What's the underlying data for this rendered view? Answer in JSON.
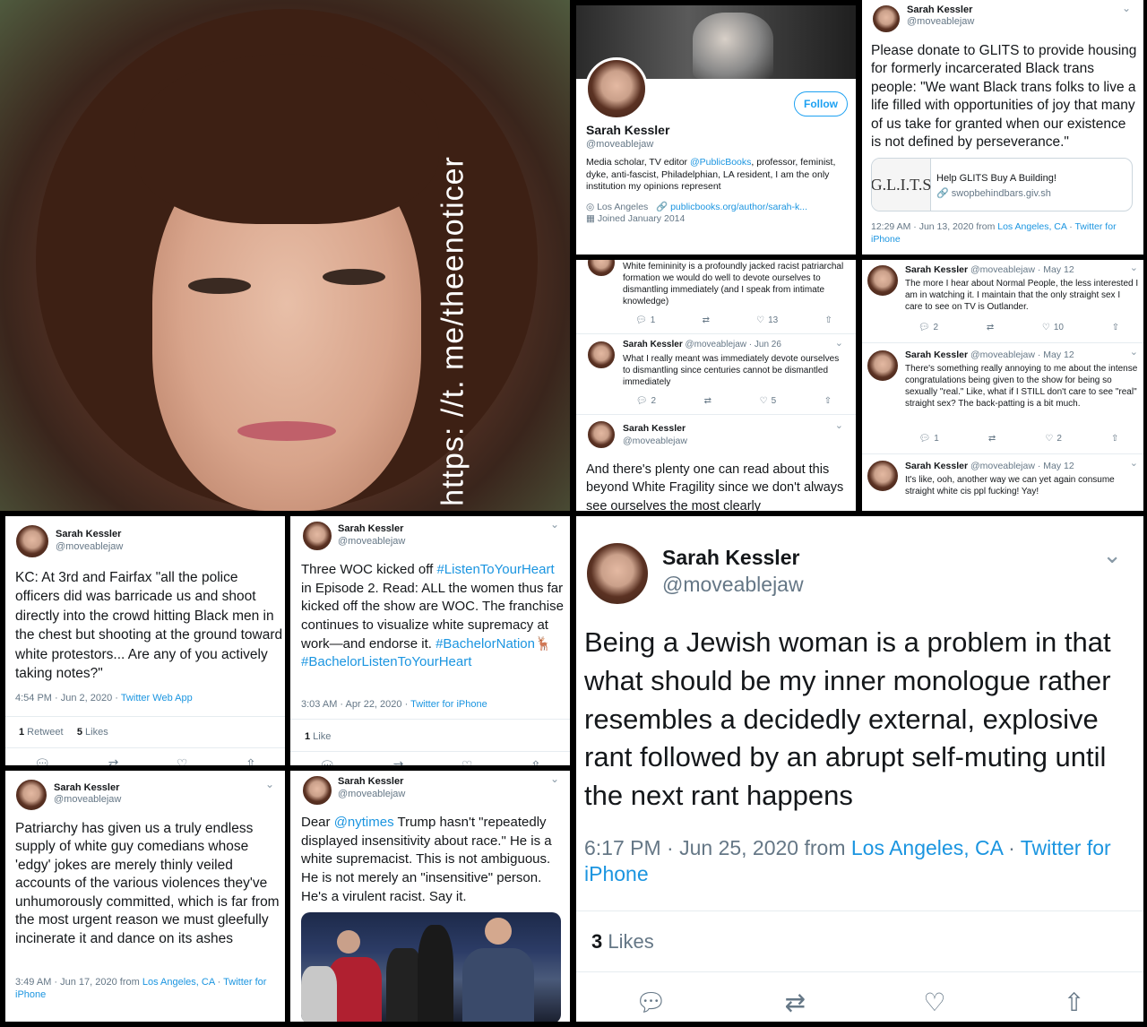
{
  "watermark": "https: //t. me/theenoticer",
  "profile": {
    "name": "Sarah Kessler",
    "handle": "@moveablejaw",
    "follow_label": "Follow",
    "bio_prefix": "Media scholar, TV editor ",
    "bio_link": "@PublicBooks",
    "bio_suffix": ", professor, feminist, dyke, anti-fascist, Philadelphian, LA resident, I am the only institution my opinions represent",
    "location": "Los Angeles",
    "website": "publicbooks.org/author/sarah-k...",
    "joined": "Joined January 2014"
  },
  "glits": {
    "name": "Sarah Kessler",
    "handle": "@moveablejaw",
    "text": "Please donate to GLITS to provide housing for formerly incarcerated Black trans people: \"We want Black trans folks to live a life filled with opportunities of joy that many of us take for granted when our existence is not defined by perseverance.\"",
    "card_thumb": "G.L.I.T.S",
    "card_title": "Help GLITS Buy A Building!",
    "card_url": "swopbehindbars.giv.sh",
    "time": "12:29 AM · Jun 13, 2020 from ",
    "place": "Los Angeles, CA",
    "sep": " · ",
    "source": "Twitter for iPhone"
  },
  "thread": {
    "t1_text": "White femininity is a profoundly jacked racist patriarchal formation we would do well to devote ourselves to dismantling immediately (and I speak from intimate knowledge)",
    "t1_reply": "1",
    "t1_like": "13",
    "t2_name": "Sarah Kessler",
    "t2_handle": "@moveablejaw · Jun 26",
    "t2_text": "What I really meant was immediately devote ourselves to dismantling since centuries cannot be dismantled immediately",
    "t2_reply": "2",
    "t2_like": "5",
    "t3_name": "Sarah Kessler",
    "t3_handle": "@moveablejaw",
    "t3_text": "And there's plenty one can read about this beyond White Fragility since we don't always see ourselves the most clearly"
  },
  "normal_people": {
    "t1_name": "Sarah Kessler",
    "t1_handle": "@moveablejaw · May 12",
    "t1_text": "The more I hear about Normal People, the less interested I am in watching it. I maintain that the only straight sex I care to see on TV is Outlander.",
    "t1_reply": "2",
    "t1_like": "10",
    "t2_name": "Sarah Kessler",
    "t2_handle": "@moveablejaw · May 12",
    "t2_text": "There's something really annoying to me about the intense congratulations being given to the show for being so sexually \"real.\" Like, what if I STILL don't care to see \"real\" straight sex? The back-patting is a bit much.",
    "t2_reply": "1",
    "t2_like": "2",
    "t3_name": "Sarah Kessler",
    "t3_handle": "@moveablejaw · May 12",
    "t3_text": "It's like, ooh, another way we can yet again consume straight white cis ppl fucking! Yay!"
  },
  "kc": {
    "name": "Sarah Kessler",
    "handle": "@moveablejaw",
    "text": "KC: At 3rd and Fairfax \"all the police officers did was barricade us and shoot directly into the crowd hitting Black men in the chest but shooting at the ground toward white protestors... Are any of you actively taking notes?\"",
    "time": "4:54 PM · Jun 2, 2020 · ",
    "source": "Twitter Web App",
    "retweets_num": "1",
    "retweets_label": " Retweet",
    "likes_num": "5",
    "likes_label": " Likes"
  },
  "woc": {
    "name": "Sarah Kessler",
    "handle": "@moveablejaw",
    "text_a": "Three WOC kicked off ",
    "tag1": "#ListenToYourHeart",
    "text_b": " in Episode 2. Read: ALL the women thus far kicked off the show are WOC. The franchise continues to visualize white supremacy at work—and endorse it. ",
    "tag2": "#BachelorNation",
    "emoji": "🦌",
    "tag3": "#BachelorListenToYourHeart",
    "time": "3:03 AM · Apr 22, 2020 · ",
    "source": "Twitter for iPhone",
    "likes_num": "1",
    "likes_label": " Like"
  },
  "jewish": {
    "name": "Sarah Kessler",
    "handle": "@moveablejaw",
    "text": "Being a Jewish woman is a problem in that what should be my inner monologue rather resembles a decidedly external, explosive rant followed by an abrupt self-muting until the next rant happens",
    "time": "6:17 PM · Jun 25, 2020 from ",
    "place": "Los Angeles, CA",
    "sep": " · ",
    "source": "Twitter for iPhone",
    "likes_num": "3",
    "likes_label": " Likes"
  },
  "patriarchy": {
    "name": "Sarah Kessler",
    "handle": "@moveablejaw",
    "text": "Patriarchy has given us a truly endless supply of white guy comedians whose 'edgy' jokes are merely thinly veiled accounts of the various violences they've unhumorously committed, which is far from the most urgent reason we must gleefully incinerate it and dance on its ashes",
    "time": "3:49 AM · Jun 17, 2020 from ",
    "place": "Los Angeles, CA",
    "sep": " · ",
    "source": "Twitter for iPhone"
  },
  "nyt": {
    "name": "Sarah Kessler",
    "handle": "@moveablejaw",
    "text_a": "Dear ",
    "mention": "@nytimes",
    "text_b": " Trump hasn't \"repeatedly displayed insensitivity about race.\" He is a white supremacist. This is not ambiguous. He is not merely an \"insensitive\" person. He's a virulent racist. Say it."
  },
  "icons": [
    "reply-icon",
    "retweet-icon",
    "like-icon",
    "share-icon",
    "chevron-down-icon",
    "location-icon",
    "link-icon",
    "calendar-icon"
  ],
  "colors": {
    "link": "#1b95e0",
    "muted": "#657786",
    "text": "#14171a",
    "follow": "#1da1f2"
  }
}
